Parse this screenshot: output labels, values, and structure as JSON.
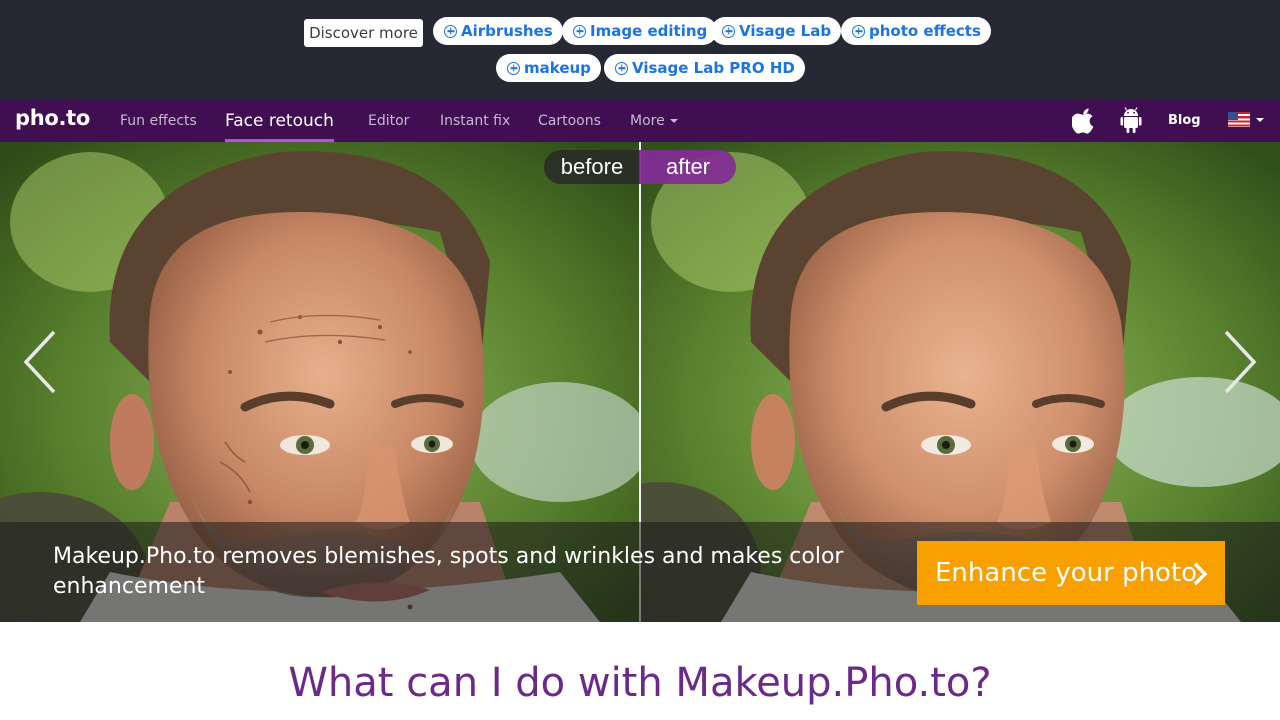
{
  "discover": {
    "label": "Discover more",
    "chips": [
      "Airbrushes",
      "Image editing",
      "Visage Lab",
      "photo effects",
      "makeup",
      "Visage Lab PRO HD"
    ]
  },
  "nav": {
    "logo": "pho.to",
    "items": [
      "Fun effects",
      "Face retouch",
      "Editor",
      "Instant fix",
      "Cartoons",
      "More"
    ],
    "active": "Face retouch",
    "blog": "Blog",
    "icons": [
      "apple-icon",
      "android-icon",
      "us-flag-icon"
    ]
  },
  "hero": {
    "before_label": "before",
    "after_label": "after",
    "caption": "Makeup.Pho.to removes blemishes, spots and wrinkles and makes color enhancement",
    "cta": "Enhance your photo",
    "accent_color": "#f7a000"
  },
  "section": {
    "title": "What can I do with Makeup.Pho.to?"
  }
}
